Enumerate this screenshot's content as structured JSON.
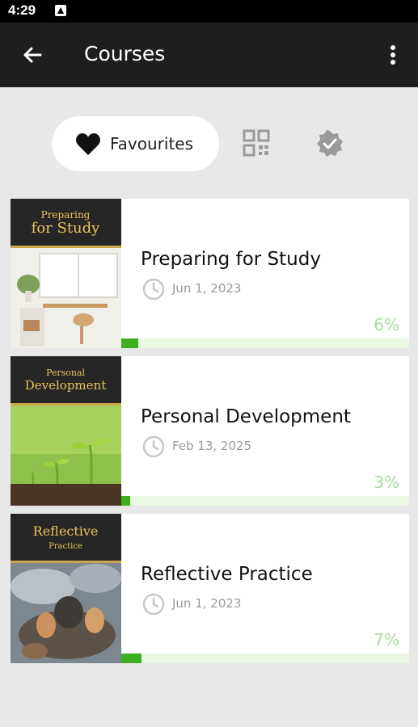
{
  "status_bar": {
    "time": "4:29"
  },
  "app_bar": {
    "title": "Courses"
  },
  "filters": {
    "favourites_label": "Favourites"
  },
  "courses": [
    {
      "cover_line1": "Preparing",
      "cover_line2": "for Study",
      "title": "Preparing for Study",
      "date": "Jun 1, 2023",
      "percent_label": "6%",
      "progress": 0.06
    },
    {
      "cover_line1": "Personal",
      "cover_line2": "Development",
      "title": "Personal Development",
      "date": "Feb 13, 2025",
      "percent_label": "3%",
      "progress": 0.03
    },
    {
      "cover_line1": "Reflective",
      "cover_line2": "Practice",
      "title": "Reflective Practice",
      "date": "Jun 1, 2023",
      "percent_label": "7%",
      "progress": 0.07
    }
  ],
  "colors": {
    "appbar": "#1e1e1e",
    "accent": "#3cb01f",
    "percent_text": "#a6dba0",
    "cover_gold": "#e8c45a"
  }
}
